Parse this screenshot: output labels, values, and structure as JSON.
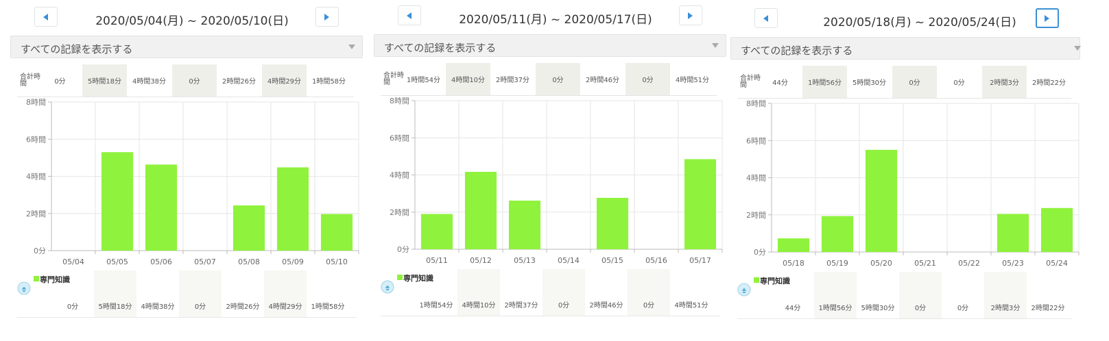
{
  "series_color": "#8ff23c",
  "panels": [
    {
      "title": "2020/05/04(月) ~ 2020/05/10(日)",
      "filter": "すべての記録を表示する",
      "total_label": "合計時間",
      "legend_name": "専門知識",
      "totals": [
        "0分",
        "5時間18分",
        "4時間38分",
        "0分",
        "2時間26分",
        "4時間29分",
        "1時間58分"
      ],
      "shaded": [
        false,
        true,
        false,
        true,
        false,
        true,
        false
      ],
      "chart_data": {
        "type": "bar",
        "categories": [
          "05/04",
          "05/05",
          "05/06",
          "05/07",
          "05/08",
          "05/09",
          "05/10"
        ],
        "series": [
          {
            "name": "専門知識",
            "values": [
              0,
              5.3,
              4.633,
              0,
              2.433,
              4.483,
              1.967
            ]
          }
        ],
        "ylim": [
          0,
          8
        ],
        "yticks": [
          "0分",
          "2時間",
          "4時間",
          "6時間",
          "8時間"
        ],
        "grid": true
      }
    },
    {
      "title": "2020/05/11(月) ~ 2020/05/17(日)",
      "filter": "すべての記録を表示する",
      "total_label": "合計時間",
      "legend_name": "専門知識",
      "totals": [
        "1時間54分",
        "4時間10分",
        "2時間37分",
        "0分",
        "2時間46分",
        "0分",
        "4時間51分"
      ],
      "shaded": [
        false,
        true,
        false,
        true,
        false,
        true,
        false
      ],
      "chart_data": {
        "type": "bar",
        "categories": [
          "05/11",
          "05/12",
          "05/13",
          "05/14",
          "05/15",
          "05/16",
          "05/17"
        ],
        "series": [
          {
            "name": "専門知識",
            "values": [
              1.9,
              4.167,
              2.617,
              0,
              2.767,
              0,
              4.85
            ]
          }
        ],
        "ylim": [
          0,
          8
        ],
        "yticks": [
          "0分",
          "2時間",
          "4時間",
          "6時間",
          "8時間"
        ],
        "grid": true
      }
    },
    {
      "title": "2020/05/18(月) ~ 2020/05/24(日)",
      "filter": "すべての記録を表示する",
      "total_label": "合計時間",
      "legend_name": "専門知識",
      "totals": [
        "44分",
        "1時間56分",
        "5時間30分",
        "0分",
        "0分",
        "2時間3分",
        "2時間22分"
      ],
      "shaded": [
        false,
        true,
        false,
        true,
        false,
        true,
        false
      ],
      "chart_data": {
        "type": "bar",
        "categories": [
          "05/18",
          "05/19",
          "05/20",
          "05/21",
          "05/22",
          "05/23",
          "05/24"
        ],
        "series": [
          {
            "name": "専門知識",
            "values": [
              0.733,
              1.933,
              5.5,
              0,
              0,
              2.05,
              2.367
            ]
          }
        ],
        "ylim": [
          0,
          8
        ],
        "yticks": [
          "0分",
          "2時間",
          "4時間",
          "6時間",
          "8時間"
        ],
        "grid": true
      }
    }
  ]
}
